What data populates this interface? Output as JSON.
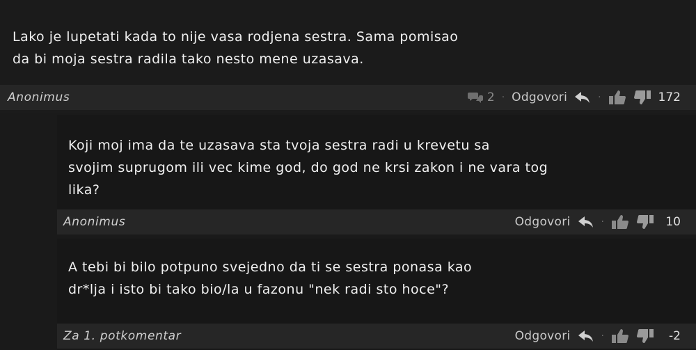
{
  "comments": [
    {
      "text": "Lako je lupetati kada to nije vasa rodjena sestra. Sama pomisao\nda bi moja sestra radila tako nesto mene uzasava.",
      "author": "Anonimus",
      "reply_count": "2",
      "reply_label": "Odgovori",
      "score": "172"
    },
    {
      "text": "Koji moj ima da te uzasava sta tvoja sestra radi u krevetu sa\nsvojim suprugom ili vec kime god, do god ne krsi zakon i ne vara tog\nlika?",
      "author": "Anonimus",
      "reply_label": "Odgovori",
      "score": "10"
    },
    {
      "text": "A tebi bi bilo potpuno svejedno da ti se sestra ponasa kao\ndr*lja i isto bi tako bio/la u fazonu \"nek radi sto hoce\"?",
      "author": "Za 1. potkomentar",
      "reply_label": "Odgovori",
      "score": "-2"
    }
  ],
  "icons": {
    "comments": "speech-bubbles-icon",
    "reply": "reply-arrow-icon",
    "like": "thumbs-up-icon",
    "dislike": "thumbs-down-icon"
  },
  "separator": "·"
}
